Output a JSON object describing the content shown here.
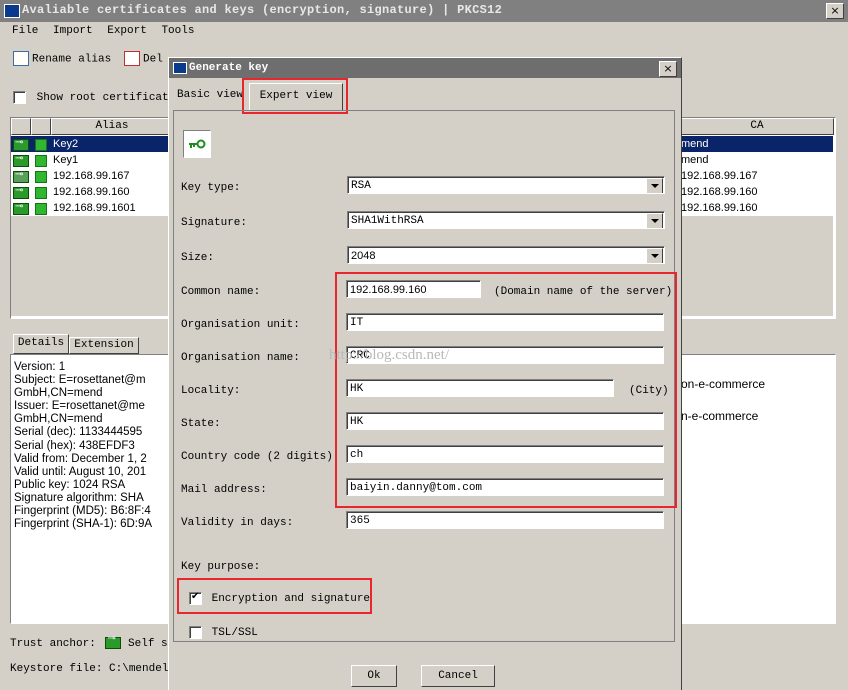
{
  "main": {
    "title": "Avaliable certificates and keys (encryption, signature) | PKCS12",
    "close": "×",
    "menu": [
      "File",
      "Import",
      "Export",
      "Tools"
    ],
    "toolbar": {
      "rename": "Rename alias",
      "delete": "Del"
    },
    "show_root": "Show root certificate",
    "table": {
      "alias_header": "Alias",
      "ca_header": "CA",
      "rows": [
        {
          "alias": "Key2",
          "ca": "mend",
          "selected": true
        },
        {
          "alias": "Key1",
          "ca": "mend"
        },
        {
          "alias": "192.168.99.167",
          "ca": "192.168.99.167"
        },
        {
          "alias": "192.168.99.160",
          "ca": "192.168.99.160"
        },
        {
          "alias": "192.168.99.1601",
          "ca": "192.168.99.160"
        }
      ]
    },
    "tabs": {
      "details": "Details",
      "extension": "Extension"
    },
    "details_lines": [
      "Version: 1",
      "Subject: E=rosettanet@m",
      "GmbH,CN=mend",
      "Issuer: E=rosettanet@me",
      "GmbH,CN=mend",
      "Serial (dec): 1133444595",
      "Serial (hex): 438EFDF3",
      "Valid from: December 1, 2",
      "Valid until: August 10, 201",
      "Public key: 1024 RSA",
      "Signature algorithm: SHA",
      "Fingerprint (MD5): B6:8F:4",
      "Fingerprint (SHA-1): 6D:9A"
    ],
    "right_text": [
      "on-e-commerce",
      "n-e-commerce"
    ],
    "trust_anchor": "Trust anchor:",
    "self_signed": "Self si",
    "keystore": "Keystore file: C:\\mendel:"
  },
  "dialog": {
    "title": "Generate key",
    "close": "×",
    "tab_basic": "Basic view",
    "tab_expert": "Expert view",
    "fields": {
      "key_type": {
        "label": "Key type:",
        "value": "RSA"
      },
      "signature": {
        "label": "Signature:",
        "value": "SHA1WithRSA"
      },
      "size": {
        "label": "Size:",
        "value": "2048"
      },
      "common_name": {
        "label": "Common name:",
        "value": "192.168.99.160",
        "hint": "(Domain name of the server)"
      },
      "org_unit": {
        "label": "Organisation unit:",
        "value": "IT"
      },
      "org_name": {
        "label": "Organisation name:",
        "value": "CRC"
      },
      "locality": {
        "label": "Locality:",
        "value": "HK",
        "hint": "(City)"
      },
      "state": {
        "label": "State:",
        "value": "HK"
      },
      "country": {
        "label": "Country code (2 digits):",
        "value": "ch"
      },
      "mail": {
        "label": "Mail address:",
        "value": "baiyin.danny@tom.com"
      },
      "validity": {
        "label": "Validity in days:",
        "value": "365"
      }
    },
    "key_purpose": "Key purpose:",
    "encryption_signature": "Encryption and signature",
    "tsl_ssl": "TSL/SSL",
    "ok": "Ok",
    "cancel": "Cancel"
  },
  "watermark": "http://blog.csdn.net/",
  "colors": {
    "highlight": "#e8262d",
    "selection": "#0a246a",
    "key_green": "#2a9a2a"
  }
}
